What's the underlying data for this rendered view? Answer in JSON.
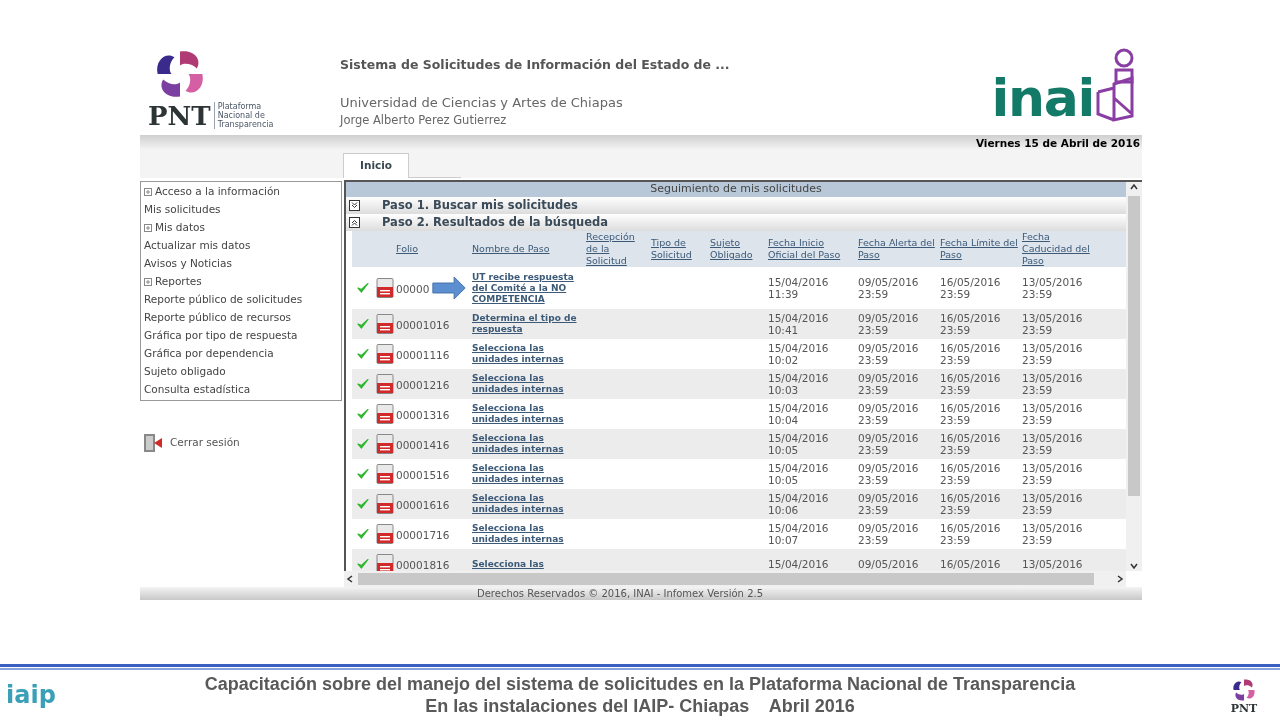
{
  "header": {
    "logo_text": "PNT",
    "logo_caption": "Plataforma Nacional de Transparencia",
    "title": "Sistema de Solicitudes de Información del Estado de ...",
    "institution": "Universidad de Ciencias y Artes de Chiapas",
    "user": "Jorge Alberto Perez Gutierrez",
    "brand": "inai",
    "date": "Viernes 15 de Abril de 2016"
  },
  "tabs": [
    {
      "label": "Inicio",
      "selected": true
    }
  ],
  "sidebar": {
    "items": [
      {
        "label": "Acceso a la información",
        "kind": "section"
      },
      {
        "label": "Mis solicitudes",
        "kind": "link"
      },
      {
        "label": "Mis datos",
        "kind": "section"
      },
      {
        "label": "Actualizar mis datos",
        "kind": "link"
      },
      {
        "label": "Avisos y Noticias",
        "kind": "link"
      },
      {
        "label": "Reportes",
        "kind": "section"
      },
      {
        "label": "Reporte público de solicitudes",
        "kind": "link"
      },
      {
        "label": "Reporte público de recursos",
        "kind": "link"
      },
      {
        "label": "Gráfica por tipo de respuesta",
        "kind": "link"
      },
      {
        "label": "Gráfica por dependencia",
        "kind": "link"
      },
      {
        "label": "Sujeto obligado",
        "kind": "link"
      },
      {
        "label": "Consulta estadística",
        "kind": "link"
      }
    ],
    "logout": "Cerrar sesión"
  },
  "panel": {
    "title": "Seguimiento de mis solicitudes",
    "steps": [
      {
        "label": "Paso 1. Buscar mis solicitudes",
        "expanded": false
      },
      {
        "label": "Paso 2. Resultados de la búsqueda",
        "expanded": true
      }
    ]
  },
  "table": {
    "columns": [
      "Folio",
      "Nombre de Paso",
      "Recepción de la Solicitud",
      "Tipo de Solicitud",
      "Sujeto Obligado",
      "Fecha Inicio Oficial del Paso",
      "Fecha Alerta del Paso",
      "Fecha Límite del Paso",
      "Fecha Caducidad del Paso"
    ],
    "rows": [
      {
        "done": true,
        "marked": true,
        "folio": "00000",
        "step": "UT recibe respuesta del Comité a la NO COMPETENCIA",
        "start": "15/04/2016 11:39",
        "alert": "09/05/2016 23:59",
        "limit": "16/05/2016 23:59",
        "expiry": "13/05/2016 23:59"
      },
      {
        "done": true,
        "marked": false,
        "folio": "00001016",
        "step": "Determina el tipo de respuesta",
        "start": "15/04/2016 10:41",
        "alert": "09/05/2016 23:59",
        "limit": "16/05/2016 23:59",
        "expiry": "13/05/2016 23:59"
      },
      {
        "done": true,
        "marked": false,
        "folio": "00001116",
        "step": "Selecciona las unidades internas",
        "start": "15/04/2016 10:02",
        "alert": "09/05/2016 23:59",
        "limit": "16/05/2016 23:59",
        "expiry": "13/05/2016 23:59"
      },
      {
        "done": true,
        "marked": false,
        "folio": "00001216",
        "step": "Selecciona las unidades internas",
        "start": "15/04/2016 10:03",
        "alert": "09/05/2016 23:59",
        "limit": "16/05/2016 23:59",
        "expiry": "13/05/2016 23:59"
      },
      {
        "done": true,
        "marked": false,
        "folio": "00001316",
        "step": "Selecciona las unidades internas",
        "start": "15/04/2016 10:04",
        "alert": "09/05/2016 23:59",
        "limit": "16/05/2016 23:59",
        "expiry": "13/05/2016 23:59"
      },
      {
        "done": true,
        "marked": false,
        "folio": "00001416",
        "step": "Selecciona las unidades internas",
        "start": "15/04/2016 10:05",
        "alert": "09/05/2016 23:59",
        "limit": "16/05/2016 23:59",
        "expiry": "13/05/2016 23:59"
      },
      {
        "done": true,
        "marked": false,
        "folio": "00001516",
        "step": "Selecciona las unidades internas",
        "start": "15/04/2016 10:05",
        "alert": "09/05/2016 23:59",
        "limit": "16/05/2016 23:59",
        "expiry": "13/05/2016 23:59"
      },
      {
        "done": true,
        "marked": false,
        "folio": "00001616",
        "step": "Selecciona las unidades internas",
        "start": "15/04/2016 10:06",
        "alert": "09/05/2016 23:59",
        "limit": "16/05/2016 23:59",
        "expiry": "13/05/2016 23:59"
      },
      {
        "done": true,
        "marked": false,
        "folio": "00001716",
        "step": "Selecciona las unidades internas",
        "start": "15/04/2016 10:07",
        "alert": "09/05/2016 23:59",
        "limit": "16/05/2016 23:59",
        "expiry": "13/05/2016 23:59"
      },
      {
        "done": true,
        "marked": false,
        "folio": "00001816",
        "step": "Selecciona las",
        "start": "15/04/2016",
        "alert": "09/05/2016",
        "limit": "16/05/2016",
        "expiry": "13/05/2016"
      }
    ]
  },
  "footer": "Derechos Reservados © 2016, INAI - Infomex Versión 2.5",
  "slide": {
    "logo_text": "iaip",
    "caption": [
      "Capacitación sobre del manejo del sistema de solicitudes en la Plataforma Nacional de Transparencia",
      "En las instalaciones del IAIP- Chiapas    Abril 2016"
    ],
    "corner_logo": "PNT"
  }
}
